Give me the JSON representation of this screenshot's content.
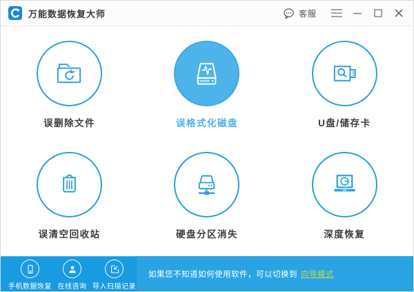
{
  "titlebar": {
    "app_title": "万能数据恢复大师",
    "support_label": "客服"
  },
  "features": [
    {
      "label": "误删除文件",
      "icon": "folder-recycle-icon",
      "highlighted": false
    },
    {
      "label": "误格式化磁盘",
      "icon": "formatted-disk-icon",
      "highlighted": true
    },
    {
      "label": "U盘/储存卡",
      "icon": "usb-search-icon",
      "highlighted": false
    },
    {
      "label": "误清空回收站",
      "icon": "trash-bin-icon",
      "highlighted": false
    },
    {
      "label": "硬盘分区消失",
      "icon": "network-disk-icon",
      "highlighted": false
    },
    {
      "label": "深度恢复",
      "icon": "laptop-scan-icon",
      "highlighted": false
    }
  ],
  "bottom_bar": {
    "actions": [
      {
        "label": "手机数据恢复",
        "icon": "phone-icon"
      },
      {
        "label": "在线咨询",
        "icon": "person-icon"
      },
      {
        "label": "导入扫描记录",
        "icon": "import-record-icon"
      }
    ],
    "hint_text": "如果您不知道如何使用软件，可以切换到",
    "hint_link_label": "向导模式"
  },
  "colors": {
    "accent_blue": "#2a9fdd",
    "highlight_fill": "#4db4ea",
    "bottom_bar_blue": "#189be1",
    "link_green": "#c4d94a"
  }
}
